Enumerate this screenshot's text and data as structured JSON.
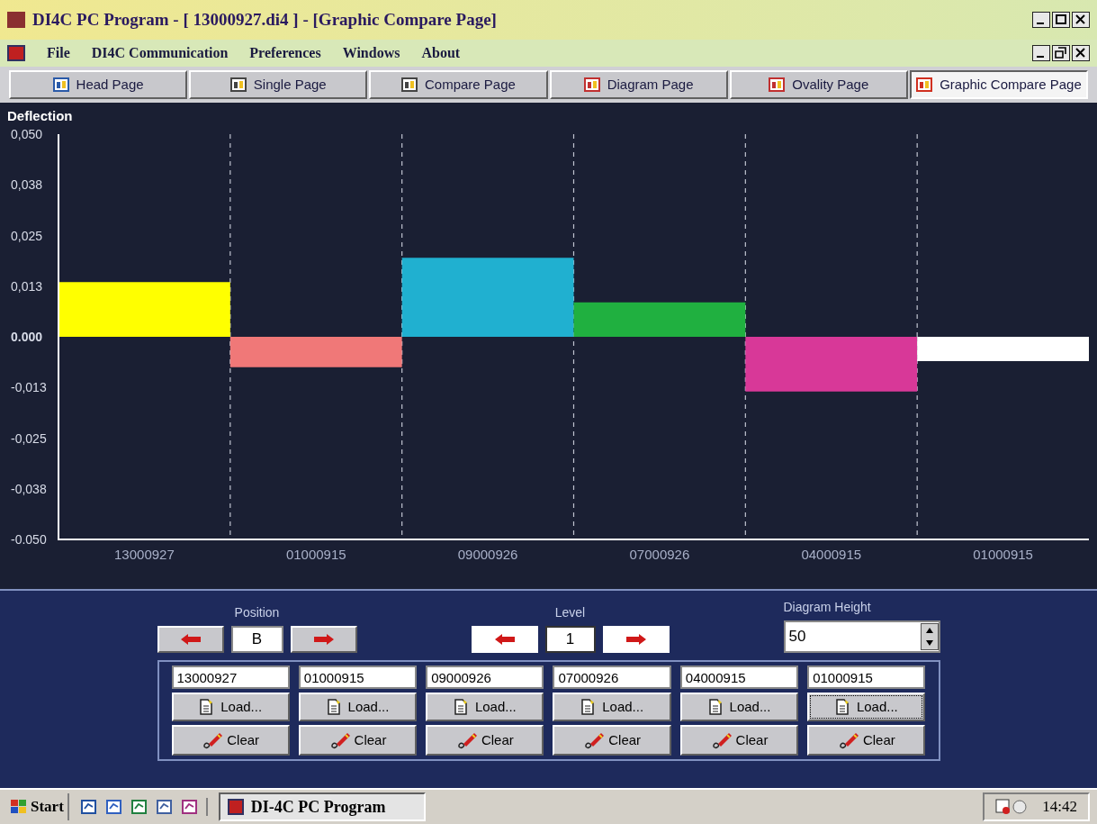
{
  "window": {
    "title": "DI4C PC Program - [ 13000927.di4 ] - [Graphic Compare Page]"
  },
  "menu": [
    "File",
    "DI4C Communication",
    "Preferences",
    "Windows",
    "About"
  ],
  "tabs": [
    {
      "label": "Head Page",
      "selected": false
    },
    {
      "label": "Single Page",
      "selected": false
    },
    {
      "label": "Compare Page",
      "selected": false
    },
    {
      "label": "Diagram Page",
      "selected": false
    },
    {
      "label": "Ovality Page",
      "selected": false
    },
    {
      "label": "Graphic Compare Page",
      "selected": true
    }
  ],
  "chart": {
    "chart_data": {
      "type": "bar",
      "ylabel": "Deflection",
      "categories": [
        "13000927",
        "01000915",
        "09000926",
        "07000926",
        "04000915",
        "01000915"
      ],
      "ylim": [
        -0.05,
        0.05
      ],
      "yticks": [
        {
          "value": 0.05,
          "label": "0,050"
        },
        {
          "value": 0.0375,
          "label": "0,038"
        },
        {
          "value": 0.025,
          "label": "0,025"
        },
        {
          "value": 0.0125,
          "label": "0,013"
        },
        {
          "value": 0,
          "label": "0.000"
        },
        {
          "value": -0.0125,
          "label": "-0,013"
        },
        {
          "value": -0.025,
          "label": "-0,025"
        },
        {
          "value": -0.0375,
          "label": "-0,038"
        },
        {
          "value": -0.05,
          "label": "-0.050"
        }
      ],
      "series": [
        {
          "color": "#ffff00",
          "values": [
            0.0135,
            null,
            null,
            null,
            null,
            null
          ]
        },
        {
          "color": "#f07878",
          "values": [
            null,
            -0.0075,
            null,
            null,
            null,
            null
          ]
        },
        {
          "color": "#20b0d0",
          "values": [
            null,
            null,
            0.0195,
            null,
            null,
            null
          ]
        },
        {
          "color": "#20b040",
          "values": [
            null,
            null,
            null,
            0.0085,
            null,
            null
          ]
        },
        {
          "color": "#d83898",
          "values": [
            null,
            null,
            null,
            null,
            -0.0135,
            null
          ]
        },
        {
          "color": "#ffffff",
          "values": [
            null,
            null,
            null,
            null,
            null,
            -0.006
          ]
        }
      ]
    }
  },
  "controls": {
    "position": {
      "label": "Position",
      "value": "B"
    },
    "level": {
      "label": "Level",
      "value": "1"
    },
    "diagram_height": {
      "label": "Diagram Height",
      "value": "50"
    }
  },
  "slots": [
    {
      "file": "13000927",
      "load": "Load...",
      "clear": "Clear",
      "focused": false
    },
    {
      "file": "01000915",
      "load": "Load...",
      "clear": "Clear",
      "focused": false
    },
    {
      "file": "09000926",
      "load": "Load...",
      "clear": "Clear",
      "focused": false
    },
    {
      "file": "07000926",
      "load": "Load...",
      "clear": "Clear",
      "focused": false
    },
    {
      "file": "04000915",
      "load": "Load...",
      "clear": "Clear",
      "focused": false
    },
    {
      "file": "01000915",
      "load": "Load...",
      "clear": "Clear",
      "focused": true
    }
  ],
  "taskbar": {
    "start": "Start",
    "task": "DI-4C PC Program",
    "clock": "14:42"
  }
}
